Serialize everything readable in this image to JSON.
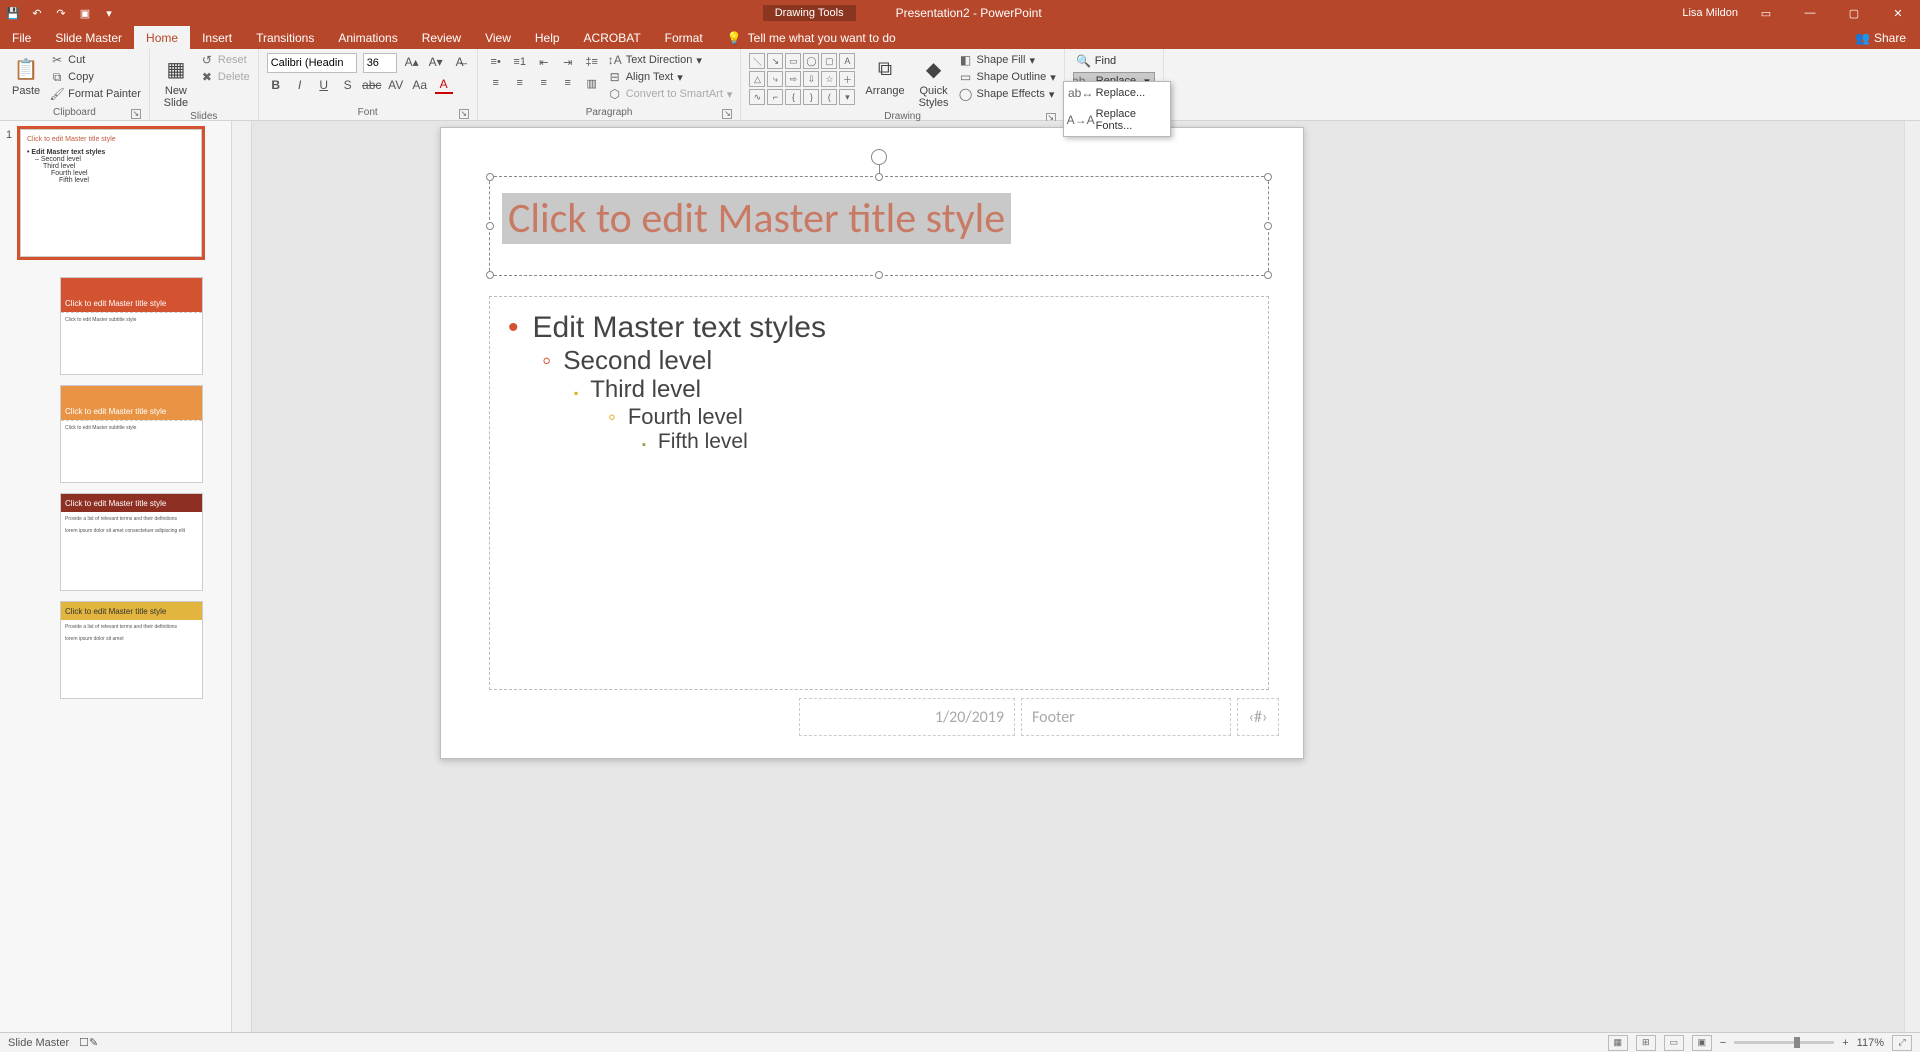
{
  "titlebar": {
    "contextual_group": "Drawing Tools",
    "doc_title": "Presentation2 - PowerPoint",
    "user": "Lisa Mildon"
  },
  "tabs": {
    "file": "File",
    "slide_master": "Slide Master",
    "home": "Home",
    "insert": "Insert",
    "transitions": "Transitions",
    "animations": "Animations",
    "review": "Review",
    "view": "View",
    "help": "Help",
    "acrobat": "ACROBAT",
    "format": "Format",
    "tell_me": "Tell me what you want to do",
    "share": "Share"
  },
  "ribbon": {
    "clipboard": {
      "paste": "Paste",
      "cut": "Cut",
      "copy": "Copy",
      "format_painter": "Format Painter",
      "label": "Clipboard"
    },
    "slides": {
      "new_slide": "New\nSlide",
      "reset": "Reset",
      "delete": "Delete",
      "label": "Slides"
    },
    "font": {
      "name": "Calibri (Headin",
      "size": "36",
      "label": "Font"
    },
    "paragraph": {
      "text_direction": "Text Direction",
      "align_text": "Align Text",
      "convert_smartart": "Convert to SmartArt",
      "label": "Paragraph"
    },
    "drawing": {
      "arrange": "Arrange",
      "quick_styles": "Quick\nStyles",
      "shape_fill": "Shape Fill",
      "shape_outline": "Shape Outline",
      "shape_effects": "Shape Effects",
      "label": "Drawing"
    },
    "editing": {
      "find": "Find",
      "replace": "Replace",
      "replace_menu": "Replace...",
      "replace_fonts": "Replace Fonts..."
    }
  },
  "slide": {
    "title_placeholder": "Click to edit Master title style",
    "lvl1": "Edit Master text styles",
    "lvl2": "Second level",
    "lvl3": "Third level",
    "lvl4": "Fourth level",
    "lvl5": "Fifth level",
    "date": "1/20/2019",
    "footer": "Footer",
    "slidenum": "‹#›"
  },
  "thumb_master": {
    "title": "Click to edit Master title style",
    "l1": "Edit Master text styles",
    "l2": "Second level",
    "l3": "Third level",
    "l4": "Fourth level",
    "l5": "Fifth level"
  },
  "thumb_layouts": {
    "title_style": "Click to edit Master title style"
  },
  "statusbar": {
    "mode": "Slide Master",
    "zoom": "117%"
  }
}
